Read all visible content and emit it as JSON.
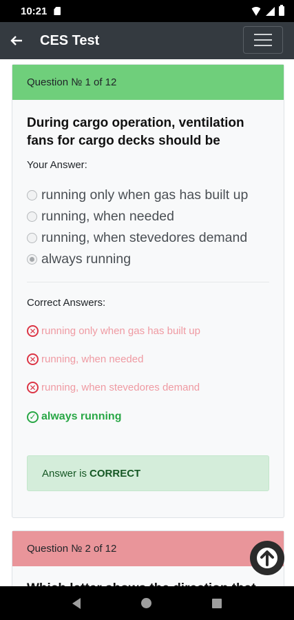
{
  "status_bar": {
    "time": "10:21"
  },
  "app_bar": {
    "title": "CES Test",
    "back_icon": "arrow-left-icon",
    "menu_icon": "hamburger-menu-icon"
  },
  "question_1": {
    "header": "Question № 1 of 12",
    "header_color": "#6fcf7b",
    "text": "During cargo operation, ventilation fans for cargo decks should be",
    "your_answer_label": "Your Answer:",
    "options": [
      {
        "label": "running only when gas has built up",
        "selected": false
      },
      {
        "label": "running, when needed",
        "selected": false
      },
      {
        "label": "running, when stevedores demand",
        "selected": false
      },
      {
        "label": "always running",
        "selected": true
      }
    ],
    "correct_answers_label": "Correct Answers:",
    "answers": [
      {
        "label": "running only when gas has built up",
        "correct": false
      },
      {
        "label": "running, when needed",
        "correct": false
      },
      {
        "label": "running, when stevedores demand",
        "correct": false
      },
      {
        "label": "always running",
        "correct": true
      }
    ],
    "result_prefix": "Answer is",
    "result_value": "CORRECT"
  },
  "question_2": {
    "header": "Question № 2 of 12",
    "header_color": "#e9959a",
    "text": "Which letter shows the direction that"
  },
  "scroll_top_icon": "arrow-up-circle-icon"
}
